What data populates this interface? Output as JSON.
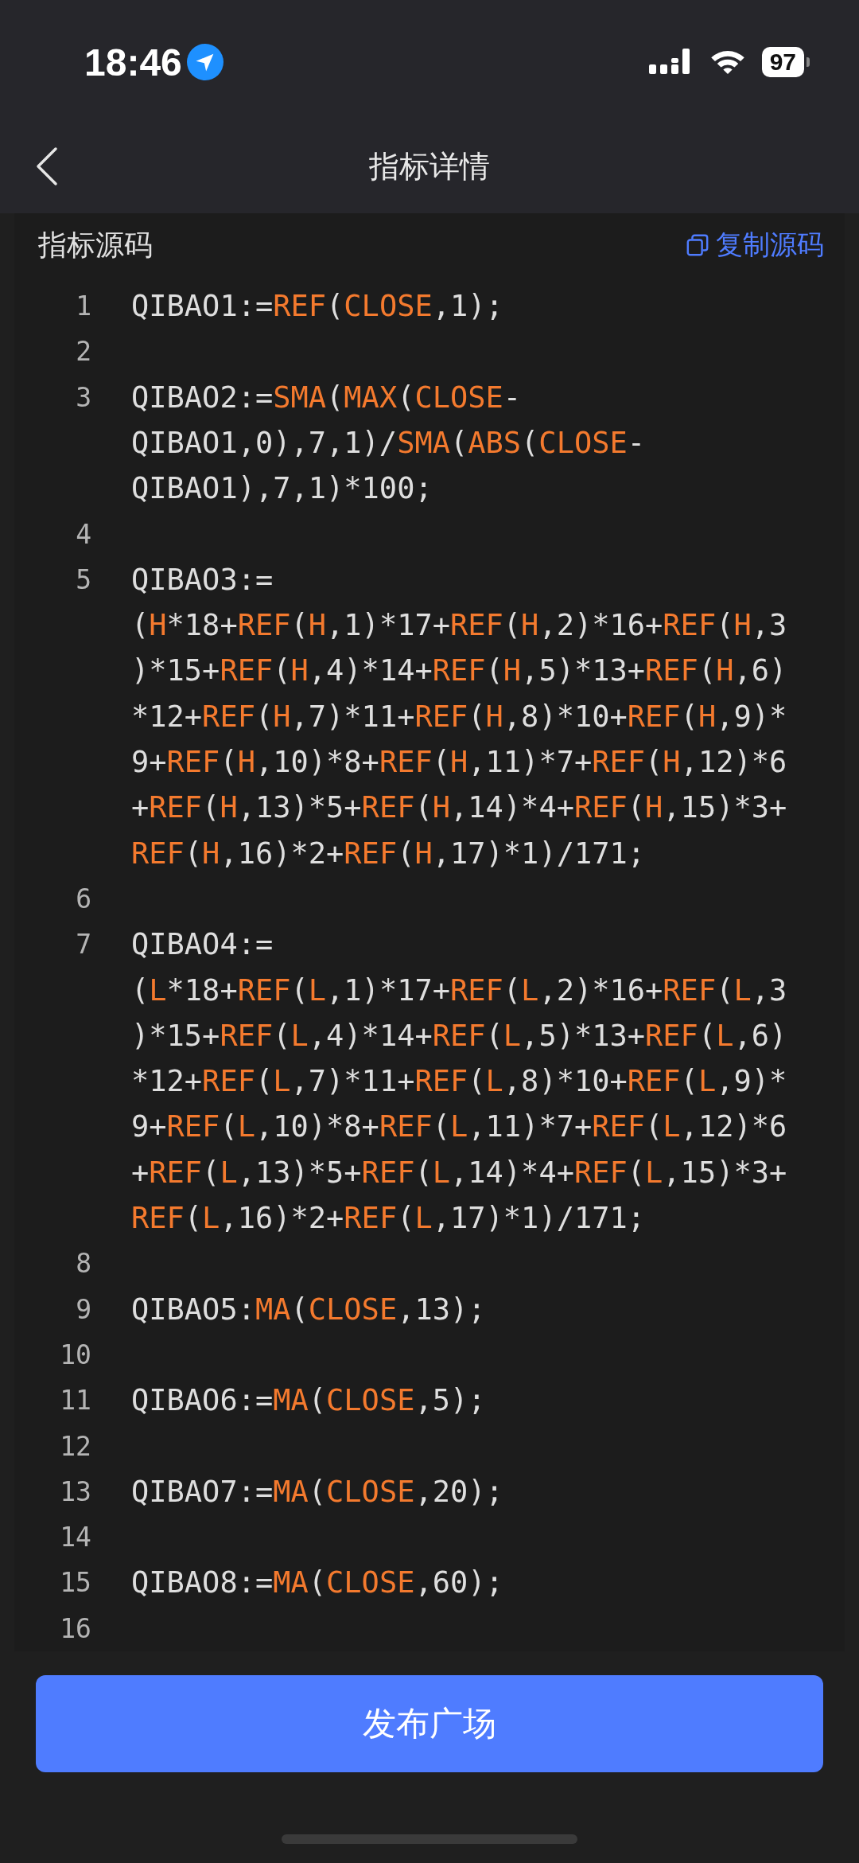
{
  "status_bar": {
    "time": "18:46",
    "battery": "97"
  },
  "nav": {
    "title": "指标详情"
  },
  "source": {
    "heading": "指标源码",
    "copy_label": "复制源码",
    "lines": [
      {
        "number": "1",
        "segments": [
          {
            "text": "QIBAO1:=",
            "kind": "plain"
          },
          {
            "text": "REF",
            "kind": "fn"
          },
          {
            "text": "(",
            "kind": "plain"
          },
          {
            "text": "CLOSE",
            "kind": "fn"
          },
          {
            "text": ",1);",
            "kind": "plain"
          }
        ]
      },
      {
        "number": "2"
      },
      {
        "number": "3",
        "segments": [
          {
            "text": "QIBAO2:=",
            "kind": "plain"
          },
          {
            "text": "SMA",
            "kind": "fn"
          },
          {
            "text": "(",
            "kind": "plain"
          },
          {
            "text": "MAX",
            "kind": "fn"
          },
          {
            "text": "(",
            "kind": "plain"
          },
          {
            "text": "CLOSE",
            "kind": "fn"
          },
          {
            "text": "-QIBAO1,0),7,1)/",
            "kind": "plain"
          },
          {
            "text": "SMA",
            "kind": "fn"
          },
          {
            "text": "(",
            "kind": "plain"
          },
          {
            "text": "ABS",
            "kind": "fn"
          },
          {
            "text": "(",
            "kind": "plain"
          },
          {
            "text": "CLOSE",
            "kind": "fn"
          },
          {
            "text": "-QIBAO1),7,1)*100;",
            "kind": "plain"
          }
        ]
      },
      {
        "number": "4"
      },
      {
        "number": "5",
        "segments": [
          {
            "text": "QIBAO3:=",
            "kind": "plain"
          },
          {
            "text": "(",
            "kind": "plain"
          },
          {
            "text": "H",
            "kind": "fn"
          },
          {
            "text": "*18+",
            "kind": "plain"
          },
          {
            "text": "REF",
            "kind": "fn"
          },
          {
            "text": "(",
            "kind": "plain"
          },
          {
            "text": "H",
            "kind": "fn"
          },
          {
            "text": ",1)*17+",
            "kind": "plain"
          },
          {
            "text": "REF",
            "kind": "fn"
          },
          {
            "text": "(",
            "kind": "plain"
          },
          {
            "text": "H",
            "kind": "fn"
          },
          {
            "text": ",2)*16+",
            "kind": "plain"
          },
          {
            "text": "REF",
            "kind": "fn"
          },
          {
            "text": "(",
            "kind": "plain"
          },
          {
            "text": "H",
            "kind": "fn"
          },
          {
            "text": ",3)*15+",
            "kind": "plain"
          },
          {
            "text": "REF",
            "kind": "fn"
          },
          {
            "text": "(",
            "kind": "plain"
          },
          {
            "text": "H",
            "kind": "fn"
          },
          {
            "text": ",4)*14+",
            "kind": "plain"
          },
          {
            "text": "REF",
            "kind": "fn"
          },
          {
            "text": "(",
            "kind": "plain"
          },
          {
            "text": "H",
            "kind": "fn"
          },
          {
            "text": ",5)*13+",
            "kind": "plain"
          },
          {
            "text": "REF",
            "kind": "fn"
          },
          {
            "text": "(",
            "kind": "plain"
          },
          {
            "text": "H",
            "kind": "fn"
          },
          {
            "text": ",6)*12+",
            "kind": "plain"
          },
          {
            "text": "REF",
            "kind": "fn"
          },
          {
            "text": "(",
            "kind": "plain"
          },
          {
            "text": "H",
            "kind": "fn"
          },
          {
            "text": ",7)*11+",
            "kind": "plain"
          },
          {
            "text": "REF",
            "kind": "fn"
          },
          {
            "text": "(",
            "kind": "plain"
          },
          {
            "text": "H",
            "kind": "fn"
          },
          {
            "text": ",8)*10+",
            "kind": "plain"
          },
          {
            "text": "REF",
            "kind": "fn"
          },
          {
            "text": "(",
            "kind": "plain"
          },
          {
            "text": "H",
            "kind": "fn"
          },
          {
            "text": ",9)*9+",
            "kind": "plain"
          },
          {
            "text": "REF",
            "kind": "fn"
          },
          {
            "text": "(",
            "kind": "plain"
          },
          {
            "text": "H",
            "kind": "fn"
          },
          {
            "text": ",10)*8+",
            "kind": "plain"
          },
          {
            "text": "REF",
            "kind": "fn"
          },
          {
            "text": "(",
            "kind": "plain"
          },
          {
            "text": "H",
            "kind": "fn"
          },
          {
            "text": ",11)*7+",
            "kind": "plain"
          },
          {
            "text": "REF",
            "kind": "fn"
          },
          {
            "text": "(",
            "kind": "plain"
          },
          {
            "text": "H",
            "kind": "fn"
          },
          {
            "text": ",12)*6+",
            "kind": "plain"
          },
          {
            "text": "REF",
            "kind": "fn"
          },
          {
            "text": "(",
            "kind": "plain"
          },
          {
            "text": "H",
            "kind": "fn"
          },
          {
            "text": ",13)*5+",
            "kind": "plain"
          },
          {
            "text": "REF",
            "kind": "fn"
          },
          {
            "text": "(",
            "kind": "plain"
          },
          {
            "text": "H",
            "kind": "fn"
          },
          {
            "text": ",14)*4+",
            "kind": "plain"
          },
          {
            "text": "REF",
            "kind": "fn"
          },
          {
            "text": "(",
            "kind": "plain"
          },
          {
            "text": "H",
            "kind": "fn"
          },
          {
            "text": ",15)*3+",
            "kind": "plain"
          },
          {
            "text": "REF",
            "kind": "fn"
          },
          {
            "text": "(",
            "kind": "plain"
          },
          {
            "text": "H",
            "kind": "fn"
          },
          {
            "text": ",16)*2+",
            "kind": "plain"
          },
          {
            "text": "REF",
            "kind": "fn"
          },
          {
            "text": "(",
            "kind": "plain"
          },
          {
            "text": "H",
            "kind": "fn"
          },
          {
            "text": ",17)*1)/171;",
            "kind": "plain"
          }
        ]
      },
      {
        "number": "6"
      },
      {
        "number": "7",
        "segments": [
          {
            "text": "QIBAO4:=",
            "kind": "plain"
          },
          {
            "text": "(",
            "kind": "plain"
          },
          {
            "text": "L",
            "kind": "fn"
          },
          {
            "text": "*18+",
            "kind": "plain"
          },
          {
            "text": "REF",
            "kind": "fn"
          },
          {
            "text": "(",
            "kind": "plain"
          },
          {
            "text": "L",
            "kind": "fn"
          },
          {
            "text": ",1)*17+",
            "kind": "plain"
          },
          {
            "text": "REF",
            "kind": "fn"
          },
          {
            "text": "(",
            "kind": "plain"
          },
          {
            "text": "L",
            "kind": "fn"
          },
          {
            "text": ",2)*16+",
            "kind": "plain"
          },
          {
            "text": "REF",
            "kind": "fn"
          },
          {
            "text": "(",
            "kind": "plain"
          },
          {
            "text": "L",
            "kind": "fn"
          },
          {
            "text": ",3)*15+",
            "kind": "plain"
          },
          {
            "text": "REF",
            "kind": "fn"
          },
          {
            "text": "(",
            "kind": "plain"
          },
          {
            "text": "L",
            "kind": "fn"
          },
          {
            "text": ",4)*14+",
            "kind": "plain"
          },
          {
            "text": "REF",
            "kind": "fn"
          },
          {
            "text": "(",
            "kind": "plain"
          },
          {
            "text": "L",
            "kind": "fn"
          },
          {
            "text": ",5)*13+",
            "kind": "plain"
          },
          {
            "text": "REF",
            "kind": "fn"
          },
          {
            "text": "(",
            "kind": "plain"
          },
          {
            "text": "L",
            "kind": "fn"
          },
          {
            "text": ",6)*12+",
            "kind": "plain"
          },
          {
            "text": "REF",
            "kind": "fn"
          },
          {
            "text": "(",
            "kind": "plain"
          },
          {
            "text": "L",
            "kind": "fn"
          },
          {
            "text": ",7)*11+",
            "kind": "plain"
          },
          {
            "text": "REF",
            "kind": "fn"
          },
          {
            "text": "(",
            "kind": "plain"
          },
          {
            "text": "L",
            "kind": "fn"
          },
          {
            "text": ",8)*10+",
            "kind": "plain"
          },
          {
            "text": "REF",
            "kind": "fn"
          },
          {
            "text": "(",
            "kind": "plain"
          },
          {
            "text": "L",
            "kind": "fn"
          },
          {
            "text": ",9)*9+",
            "kind": "plain"
          },
          {
            "text": "REF",
            "kind": "fn"
          },
          {
            "text": "(",
            "kind": "plain"
          },
          {
            "text": "L",
            "kind": "fn"
          },
          {
            "text": ",10)*8+",
            "kind": "plain"
          },
          {
            "text": "REF",
            "kind": "fn"
          },
          {
            "text": "(",
            "kind": "plain"
          },
          {
            "text": "L",
            "kind": "fn"
          },
          {
            "text": ",11)*7+",
            "kind": "plain"
          },
          {
            "text": "REF",
            "kind": "fn"
          },
          {
            "text": "(",
            "kind": "plain"
          },
          {
            "text": "L",
            "kind": "fn"
          },
          {
            "text": ",12)*6+",
            "kind": "plain"
          },
          {
            "text": "REF",
            "kind": "fn"
          },
          {
            "text": "(",
            "kind": "plain"
          },
          {
            "text": "L",
            "kind": "fn"
          },
          {
            "text": ",13)*5+",
            "kind": "plain"
          },
          {
            "text": "REF",
            "kind": "fn"
          },
          {
            "text": "(",
            "kind": "plain"
          },
          {
            "text": "L",
            "kind": "fn"
          },
          {
            "text": ",14)*4+",
            "kind": "plain"
          },
          {
            "text": "REF",
            "kind": "fn"
          },
          {
            "text": "(",
            "kind": "plain"
          },
          {
            "text": "L",
            "kind": "fn"
          },
          {
            "text": ",15)*3+",
            "kind": "plain"
          },
          {
            "text": "REF",
            "kind": "fn"
          },
          {
            "text": "(",
            "kind": "plain"
          },
          {
            "text": "L",
            "kind": "fn"
          },
          {
            "text": ",16)*2+",
            "kind": "plain"
          },
          {
            "text": "REF",
            "kind": "fn"
          },
          {
            "text": "(",
            "kind": "plain"
          },
          {
            "text": "L",
            "kind": "fn"
          },
          {
            "text": ",17)*1)/171;",
            "kind": "plain"
          }
        ]
      },
      {
        "number": "8"
      },
      {
        "number": "9",
        "segments": [
          {
            "text": "QIBAO5:",
            "kind": "plain"
          },
          {
            "text": "MA",
            "kind": "fn"
          },
          {
            "text": "(",
            "kind": "plain"
          },
          {
            "text": "CLOSE",
            "kind": "fn"
          },
          {
            "text": ",13);",
            "kind": "plain"
          }
        ]
      },
      {
        "number": "10"
      },
      {
        "number": "11",
        "segments": [
          {
            "text": "QIBAO6:=",
            "kind": "plain"
          },
          {
            "text": "MA",
            "kind": "fn"
          },
          {
            "text": "(",
            "kind": "plain"
          },
          {
            "text": "CLOSE",
            "kind": "fn"
          },
          {
            "text": ",5);",
            "kind": "plain"
          }
        ]
      },
      {
        "number": "12"
      },
      {
        "number": "13",
        "segments": [
          {
            "text": "QIBAO7:=",
            "kind": "plain"
          },
          {
            "text": "MA",
            "kind": "fn"
          },
          {
            "text": "(",
            "kind": "plain"
          },
          {
            "text": "CLOSE",
            "kind": "fn"
          },
          {
            "text": ",20);",
            "kind": "plain"
          }
        ]
      },
      {
        "number": "14"
      },
      {
        "number": "15",
        "segments": [
          {
            "text": "QIBAO8:=",
            "kind": "plain"
          },
          {
            "text": "MA",
            "kind": "fn"
          },
          {
            "text": "(",
            "kind": "plain"
          },
          {
            "text": "CLOSE",
            "kind": "fn"
          },
          {
            "text": ",60);",
            "kind": "plain"
          }
        ]
      },
      {
        "number": "16"
      }
    ]
  },
  "publish_button": {
    "label": "发布广场"
  }
}
